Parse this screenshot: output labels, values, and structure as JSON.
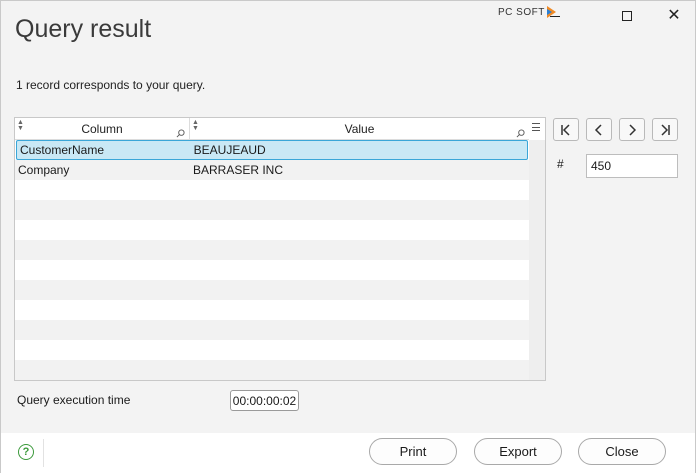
{
  "window": {
    "brand": "PC SOFT",
    "title": "Query result",
    "subtitle": "1 record corresponds to your query."
  },
  "table": {
    "columns": [
      "Column",
      "Value"
    ],
    "rows": [
      {
        "column": "CustomerName",
        "value": "BEAUJEAUD",
        "selected": true
      },
      {
        "column": "Company",
        "value": "BARRASER INC",
        "selected": false
      }
    ]
  },
  "navigation": {
    "record_label": "#",
    "record_value": "450",
    "buttons": [
      "first-record",
      "previous-record",
      "next-record",
      "last-record"
    ]
  },
  "execution": {
    "label": "Query execution time",
    "value": "00:00:00:02"
  },
  "footer": {
    "print": "Print",
    "export": "Export",
    "close": "Close"
  }
}
